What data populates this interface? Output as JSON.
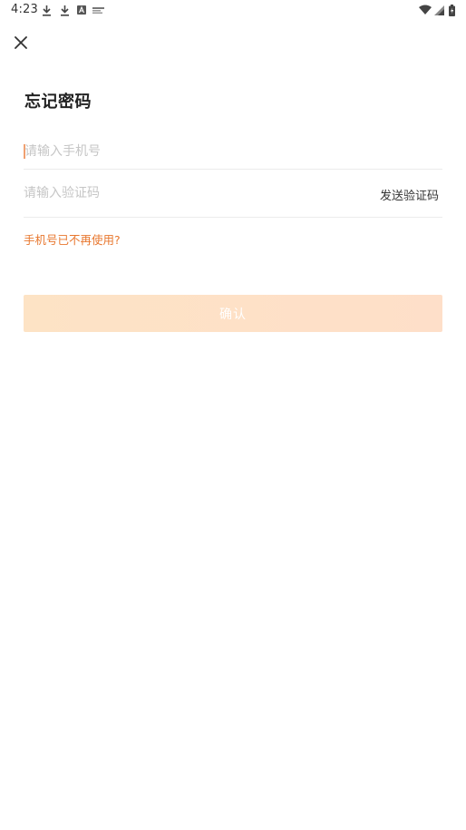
{
  "status_bar": {
    "time": "4:23",
    "icons": [
      "download-icon",
      "download-icon",
      "a-badge-icon",
      "notification-icon",
      "wifi-icon",
      "signal-icon",
      "battery-icon"
    ]
  },
  "header": {
    "close_icon": "close-icon",
    "title": "忘记密码"
  },
  "form": {
    "phone_placeholder": "请输入手机号",
    "phone_value": "",
    "code_placeholder": "请输入验证码",
    "code_value": "",
    "send_code_label": "发送验证码",
    "phone_unavailable_label": "手机号已不再使用?",
    "confirm_label": "确认"
  },
  "colors": {
    "accent": "#e8772e",
    "caret": "#f0a070",
    "button_bg": "#fde3c5",
    "divider": "#ececec"
  }
}
